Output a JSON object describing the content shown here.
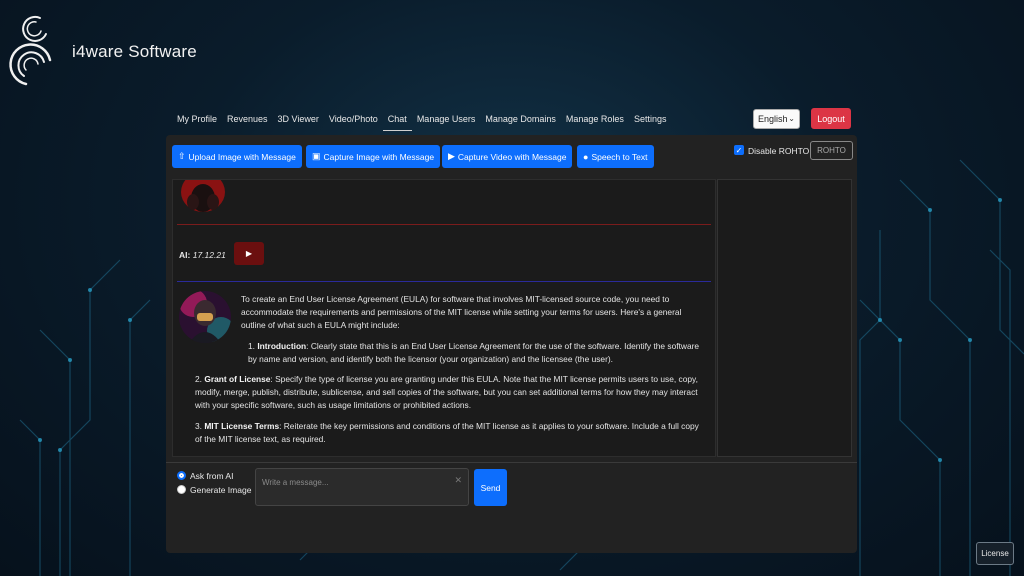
{
  "brand": {
    "name": "i4ware Software"
  },
  "nav": {
    "items": [
      {
        "label": "My Profile"
      },
      {
        "label": "Revenues"
      },
      {
        "label": "3D Viewer"
      },
      {
        "label": "Video/Photo"
      },
      {
        "label": "Chat"
      },
      {
        "label": "Manage Users"
      },
      {
        "label": "Manage Domains"
      },
      {
        "label": "Manage Roles"
      },
      {
        "label": "Settings"
      }
    ],
    "active": "Chat"
  },
  "language": {
    "selected": "English"
  },
  "logout_label": "Logout",
  "toolbar": {
    "upload_label": "Upload Image with Message",
    "capture_image_label": "Capture Image with Message",
    "capture_video_label": "Capture Video with Message",
    "speech_label": "Speech to Text",
    "disable_rohto_label": "Disable ROHTO",
    "rohto_button_label": "ROHTO"
  },
  "chat": {
    "ai_prefix": "AI:",
    "ai_time": "17.12.21",
    "play_glyph": "▶",
    "message": {
      "intro": "To create an End User License Agreement (EULA) for software that involves MIT-licensed source code, you need to accommodate the requirements and permissions of the MIT license while setting your terms for users. Here's a general outline of what such a EULA might include:",
      "items": [
        {
          "num": "1.",
          "title": "Introduction",
          "text": ": Clearly state that this is an End User License Agreement for the use of the software. Identify the software by name and version, and identify both the licensor (your organization) and the licensee (the user)."
        },
        {
          "num": "2.",
          "title": "Grant of License",
          "text": ": Specify the type of license you are granting under this EULA. Note that the MIT license permits users to use, copy, modify, merge, publish, distribute, sublicense, and sell copies of the software, but you can set additional terms for how they may interact with your specific software, such as usage limitations or prohibited actions."
        },
        {
          "num": "3.",
          "title": "MIT License Terms",
          "text": ": Reiterate the key permissions and conditions of the MIT license as it applies to your software. Include a full copy of the MIT license text, as required."
        }
      ]
    }
  },
  "composer": {
    "option_ask": "Ask from AI",
    "option_generate": "Generate Image",
    "selected": "Ask from AI",
    "placeholder": "Write a message...",
    "send_label": "Send"
  },
  "license_label": "License",
  "colors": {
    "primary": "#0d6efd",
    "danger": "#dc3545",
    "panel": "#222222"
  }
}
